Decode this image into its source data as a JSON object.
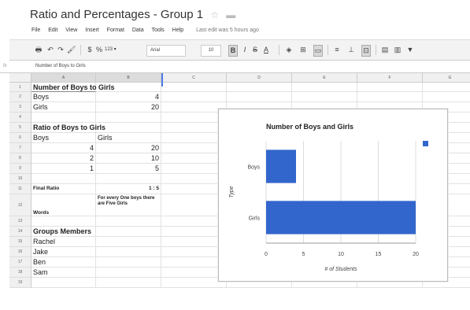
{
  "doc": {
    "title": "Ratio and Percentages - Group 1",
    "star_icon": "☆",
    "folder_icon": "▬"
  },
  "menu": {
    "items": [
      "File",
      "Edit",
      "View",
      "Insert",
      "Format",
      "Data",
      "Tools",
      "Help"
    ],
    "last_edit": "Last edit was 5 hours ago"
  },
  "toolbar": {
    "print": "🖶",
    "undo": "↶",
    "redo": "↷",
    "paint": "🖌",
    "currency": "$",
    "percent": "%",
    "more_formats": "123 ▾",
    "font": "Arial",
    "size": "10",
    "bold": "B",
    "italic": "I",
    "strike": "S",
    "text_color": "A",
    "fill": "◈",
    "borders": "⊞",
    "merge": "▭",
    "align": "≡",
    "valign": "⊥",
    "wrap": "⊡",
    "comment": "▤",
    "chart": "▥",
    "filter": "▼"
  },
  "formula_bar": {
    "fx": "fx",
    "value": "Number of Boys to Girls"
  },
  "columns": [
    "A",
    "B",
    "C",
    "D",
    "E",
    "F",
    "G"
  ],
  "rows": [
    "1",
    "2",
    "3",
    "4",
    "5",
    "6",
    "7",
    "8",
    "9",
    "10",
    "11",
    "12",
    "13",
    "14",
    "15",
    "16",
    "17",
    "18",
    "19"
  ],
  "cells": {
    "a1": "Number of Boys to Girls",
    "a2": "Boys",
    "b2": "4",
    "a3": "Girls",
    "b3": "20",
    "a5": "Ratio of Boys to Girls",
    "a6": "Boys",
    "b6": "Girls",
    "a7": "4",
    "b7": "20",
    "a8": "2",
    "b8": "10",
    "a9": "1",
    "b9": "5",
    "a11": "Final Ratio",
    "b11": "1 : 5",
    "a12": "Words",
    "b12": "For every One boys there are Five Girls",
    "a14": "Groups Members",
    "a15": "Rachel",
    "a16": "Jake",
    "a17": "Ben",
    "a18": "Sam"
  },
  "chart_data": {
    "type": "bar",
    "orientation": "horizontal",
    "title": "Number of Boys and Girls",
    "categories": [
      "Boys",
      "Girls"
    ],
    "values": [
      4,
      20
    ],
    "xlabel": "# of Students",
    "ylabel": "Type",
    "xticks": [
      "0",
      "5",
      "10",
      "15",
      "20"
    ],
    "xlim": [
      0,
      20
    ],
    "grid": true,
    "legend": "right",
    "bar_color": "#3366cc"
  }
}
